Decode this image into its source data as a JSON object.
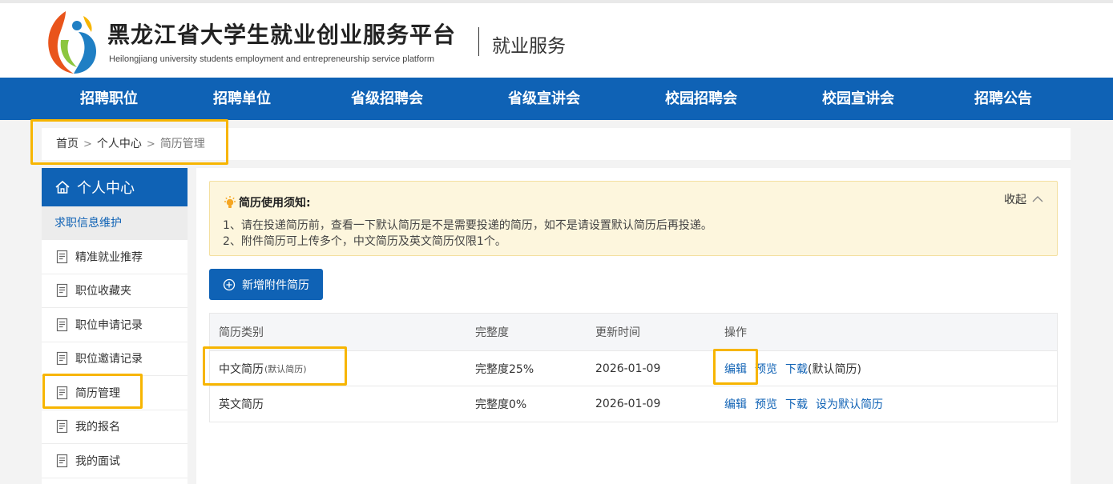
{
  "header": {
    "title": "黑龙江省大学生就业创业服务平台",
    "subtitle": "Heilongjiang university students employment and entrepreneurship service platform",
    "service_label": "就业服务"
  },
  "nav": [
    {
      "label": "招聘职位"
    },
    {
      "label": "招聘单位"
    },
    {
      "label": "省级招聘会"
    },
    {
      "label": "省级宣讲会"
    },
    {
      "label": "校园招聘会"
    },
    {
      "label": "校园宣讲会"
    },
    {
      "label": "招聘公告"
    }
  ],
  "breadcrumb": {
    "home": "首页",
    "center": "个人中心",
    "current": "简历管理"
  },
  "sidebar": {
    "title": "个人中心",
    "group": "求职信息维护",
    "items": [
      {
        "label": "精准就业推荐"
      },
      {
        "label": "职位收藏夹"
      },
      {
        "label": "职位申请记录"
      },
      {
        "label": "职位邀请记录"
      },
      {
        "label": "简历管理"
      },
      {
        "label": "我的报名"
      },
      {
        "label": "我的面试"
      }
    ]
  },
  "notice": {
    "title": "简历使用须知:",
    "line1": "1、请在投递简历前，查看一下默认简历是不是需要投递的简历，如不是请设置默认简历后再投递。",
    "line2": "2、附件简历可上传多个，中文简历及英文简历仅限1个。",
    "collapse": "收起"
  },
  "add_button": "新增附件简历",
  "table": {
    "headers": [
      "简历类别",
      "完整度",
      "更新时间",
      "操作"
    ],
    "rows": [
      {
        "type": "中文简历",
        "type_note": "(默认简历)",
        "completeness": "完整度25%",
        "updated": "2026-01-09",
        "edit": "编辑",
        "preview": "预览",
        "download": "下载",
        "extra": "(默认简历)"
      },
      {
        "type": "英文简历",
        "completeness": "完整度0%",
        "updated": "2026-01-09",
        "edit": "编辑",
        "preview": "预览",
        "download": "下载",
        "set_default": "设为默认简历"
      }
    ]
  },
  "colors": {
    "primary": "#0f62b5",
    "highlight": "#f7b500",
    "notice_bg": "#fdf6dd"
  },
  "icons": {
    "logo": "platform-logo",
    "home": "home-icon",
    "doc": "document-icon",
    "bulb": "lightbulb-icon",
    "up": "chevron-up-icon",
    "add": "plus-circle-icon"
  }
}
